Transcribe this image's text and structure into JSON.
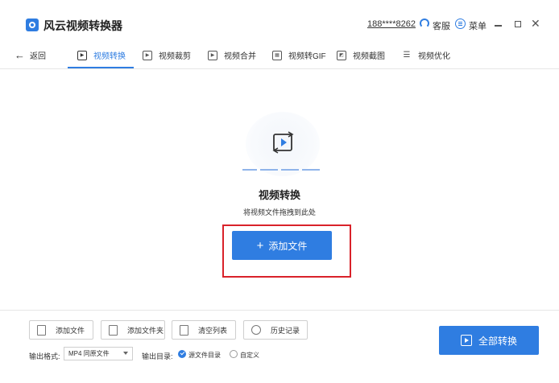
{
  "window": {
    "title": "风云视频转换器",
    "phone": "188****8262",
    "kefu_label": "客服",
    "menu_label": "菜单",
    "close_glyph": "✕"
  },
  "tabs": {
    "back_label": "返回",
    "items": [
      {
        "label": "视频转换",
        "icon": "video-convert-icon",
        "active": true
      },
      {
        "label": "视频裁剪",
        "icon": "video-crop-icon",
        "active": false
      },
      {
        "label": "视频合并",
        "icon": "video-merge-icon",
        "active": false
      },
      {
        "label": "视频转GIF",
        "icon": "video-gif-icon",
        "active": false
      },
      {
        "label": "视频截图",
        "icon": "video-screenshot-icon",
        "active": false
      },
      {
        "label": "视频优化",
        "icon": "video-optimize-icon",
        "active": false
      }
    ]
  },
  "main": {
    "title": "视频转换",
    "hint": "将视频文件拖拽到此处",
    "add_file_label": "添加文件",
    "plus_glyph": "+"
  },
  "bottom": {
    "buttons": {
      "add_file": "添加文件",
      "add_folder": "添加文件夹",
      "clear_list": "清空列表",
      "history": "历史记录"
    },
    "format_label": "输出格式:",
    "format_value": "MP4 同原文件",
    "dir_label": "输出目录:",
    "dir_options": [
      {
        "label": "源文件目录",
        "checked": true
      },
      {
        "label": "自定义",
        "checked": false
      }
    ],
    "convert_all_label": "全部转换"
  },
  "colors": {
    "accent": "#2f7de1",
    "highlight": "#d9222a"
  }
}
